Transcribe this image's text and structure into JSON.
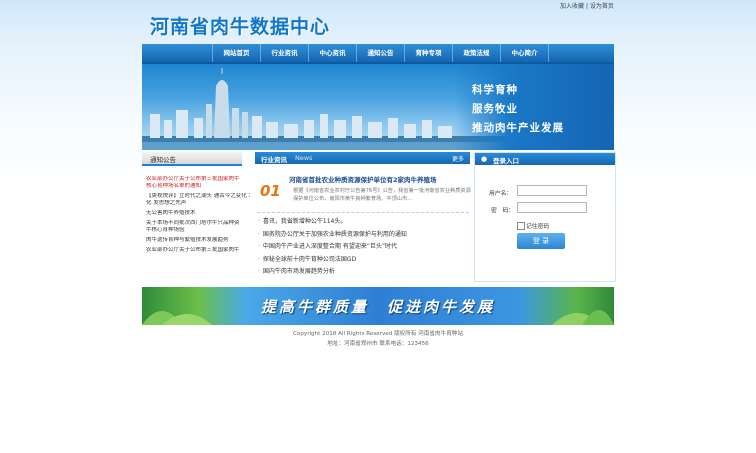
{
  "top_links": {
    "favorite": "加入收藏",
    "sep": "|",
    "homepage": "设为首页"
  },
  "site_title": "河南省肉牛数据中心",
  "nav": [
    "网站首页",
    "行业资讯",
    "中心资讯",
    "通知公告",
    "育种专项",
    "政策法规",
    "中心简介"
  ],
  "banner": {
    "slogans": [
      "科学育种",
      "服务牧业",
      "推动肉牛产业发展"
    ]
  },
  "notice": {
    "title": "通知公告",
    "items": [
      {
        "text": "农业部办公厅关于公布第三批国家肉牛",
        "red": true
      },
      {
        "text": "核心育种场名单的通知",
        "red": true
      },
      {
        "text": "【央视快评】立时代之潮头 通古今之变化 发思想之先声",
        "red": false
      },
      {
        "text": "化 发思想之先声",
        "red": false
      },
      {
        "text": "无公害肉牛养殖技术",
        "red": false
      },
      {
        "text": "关于本场不同批次西门塔尔牛只品种资",
        "red": false
      },
      {
        "text": "牛核心育种场验",
        "red": false
      },
      {
        "text": "肉牛遗传育种与繁殖技术发展趋势",
        "red": false
      },
      {
        "text": "农业部办公厅关于公布第三批国家肉牛",
        "red": false
      }
    ]
  },
  "news": {
    "tab": "行业资讯",
    "sub": "News",
    "more": "更多",
    "headline": {
      "title": "河南省首批农业种质资源保护单位有2家肉牛养殖场",
      "badge": "01",
      "text": "根据《河南省农业农村厅公告第76号》公告，我省第一批河南省农业种质资源保护单位公布，南阳市黄牛良种繁育场、平顶山市..."
    },
    "items": [
      "喜讯，我省新增种公牛114头。",
      "国务院办公厅关于加强农业种质资源保护与利用的通知",
      "中国肉牛产业进入深度整合期 有望迎来“巨头”时代",
      "探秘全球前十肉牛育种公司法国GD",
      "国内牛肉市场发展趋势分析"
    ]
  },
  "login": {
    "title": "登录入口",
    "username_label": "用户名：",
    "password_label": "密　码：",
    "username_value": "",
    "password_value": "",
    "remember_label": "记住密码",
    "button": "登 录"
  },
  "slogan_banner": "提高牛群质量　促进肉牛发展",
  "footer": {
    "line1": "Copyright 2018 All Rights Reserved 版权所有 河南省肉牛育种站",
    "line2": "地址：河南省郑州市 联系电话：123456"
  },
  "colors": {
    "accent": "#1377c8",
    "nav": "#1f7fd0",
    "notice_red": "#d41a1a"
  }
}
